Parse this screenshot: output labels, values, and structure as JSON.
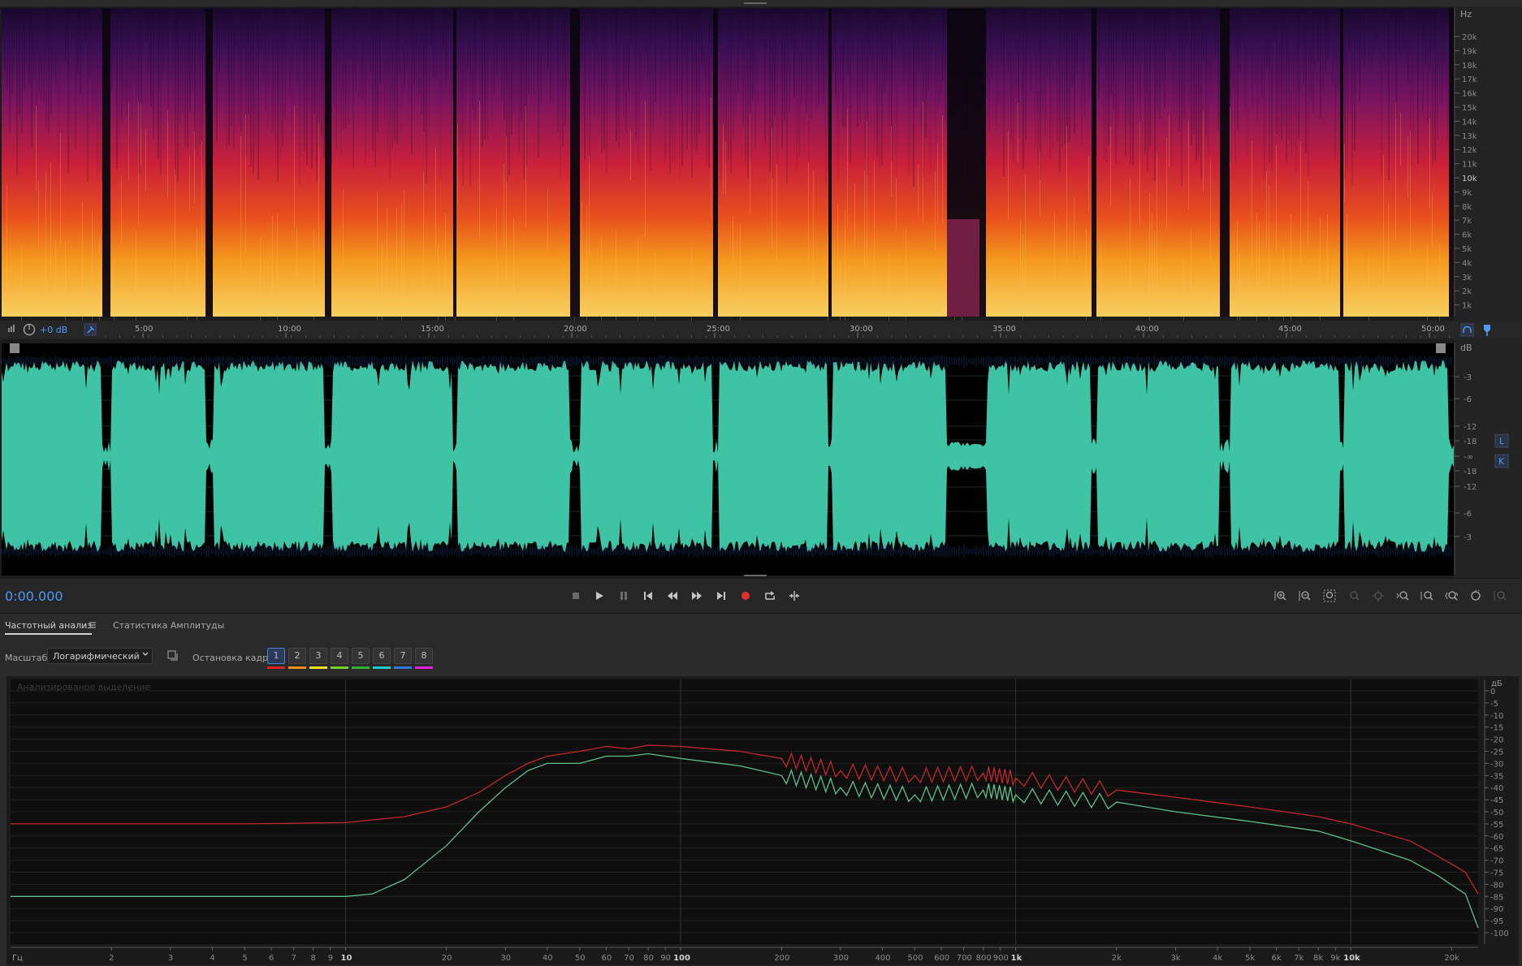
{
  "spectrogram": {
    "freq_unit": "Hz",
    "freq_labels": [
      "20k",
      "19k",
      "18k",
      "17k",
      "16k",
      "15k",
      "14k",
      "13k",
      "12k",
      "11k",
      "10k",
      "9k",
      "8k",
      "7k",
      "6k",
      "5k",
      "4k",
      "3k",
      "2k",
      "1k"
    ]
  },
  "ruler": {
    "gain": "+0 dB",
    "time_labels": [
      "5:00",
      "10:00",
      "15:00",
      "20:00",
      "25:00",
      "30:00",
      "35:00",
      "40:00",
      "45:00",
      "50:00"
    ]
  },
  "waveform": {
    "amp_unit": "dB",
    "amp_labels": [
      "-3",
      "-6",
      "-12",
      "-18",
      "-∞",
      "-18",
      "-12",
      "-6",
      "-3"
    ],
    "channel_left": "L",
    "channel_right": "K"
  },
  "transport": {
    "timecode": "0:00.000"
  },
  "panel": {
    "tabs": [
      {
        "label": "Частотный анализ",
        "active": true
      },
      {
        "label": "Статистика Амплитуды",
        "active": false
      }
    ],
    "scale_label": "Масштаб:",
    "scale_value": "Логарифмический",
    "freeze_label": "Остановка кадра:",
    "freeze_buttons": [
      "1",
      "2",
      "3",
      "4",
      "5",
      "6",
      "7",
      "8"
    ],
    "freeze_colors": [
      "#e02020",
      "#f08c1e",
      "#f0e020",
      "#78d030",
      "#30b030",
      "#20c8d0",
      "#3078e0",
      "#e020e0"
    ],
    "graph_label": "Анализированое выделение"
  },
  "chart_data": {
    "type": "line",
    "title": "Анализированое выделение",
    "xlabel": "Гц",
    "ylabel": "дБ",
    "x_scale": "log",
    "xlim": [
      1,
      24000
    ],
    "ylim": [
      -100,
      0
    ],
    "x_ticks": [
      "2",
      "3",
      "4",
      "5",
      "6",
      "7",
      "8",
      "9",
      "10",
      "20",
      "30",
      "40",
      "50",
      "60",
      "70",
      "80",
      "90",
      "100",
      "200",
      "300",
      "400",
      "500",
      "600",
      "700",
      "800",
      "900",
      "1k",
      "2k",
      "3k",
      "4k",
      "5k",
      "6k",
      "7k",
      "8k",
      "9k",
      "10k",
      "20k"
    ],
    "y_ticks": [
      "0",
      "-5",
      "-10",
      "-15",
      "-20",
      "-25",
      "-30",
      "-35",
      "-40",
      "-45",
      "-50",
      "-55",
      "-60",
      "-65",
      "-70",
      "-75",
      "-80",
      "-85",
      "-90",
      "-95",
      "-100"
    ],
    "grid": true,
    "series": [
      {
        "color": "#c0282e",
        "x": [
          1,
          5,
          10,
          15,
          20,
          25,
          30,
          35,
          40,
          50,
          60,
          70,
          80,
          100,
          150,
          200,
          300,
          500,
          800,
          1000,
          2000,
          3000,
          5000,
          8000,
          10000,
          15000,
          18000,
          22000,
          24000
        ],
        "y": [
          -55,
          -55,
          -54.5,
          -52,
          -48,
          -42,
          -35,
          -30,
          -27,
          -25,
          -23,
          -24,
          -22.5,
          -23,
          -25,
          -28,
          -33,
          -35,
          -34,
          -36,
          -41,
          -44,
          -48,
          -52,
          -55,
          -62,
          -68,
          -75,
          -84
        ]
      },
      {
        "color": "#5fbf8f",
        "x": [
          1,
          5,
          10,
          12,
          15,
          20,
          25,
          30,
          35,
          40,
          50,
          60,
          70,
          80,
          100,
          150,
          200,
          300,
          500,
          800,
          1000,
          2000,
          3000,
          5000,
          8000,
          10000,
          15000,
          18000,
          22000,
          24000
        ],
        "y": [
          -85,
          -85,
          -85,
          -84,
          -78,
          -64,
          -50,
          -40,
          -33,
          -30,
          -30,
          -27,
          -27,
          -26,
          -28,
          -31,
          -35,
          -40,
          -43,
          -41,
          -43,
          -46,
          -50,
          -54,
          -58,
          -62,
          -70,
          -76,
          -84,
          -98
        ]
      }
    ]
  }
}
